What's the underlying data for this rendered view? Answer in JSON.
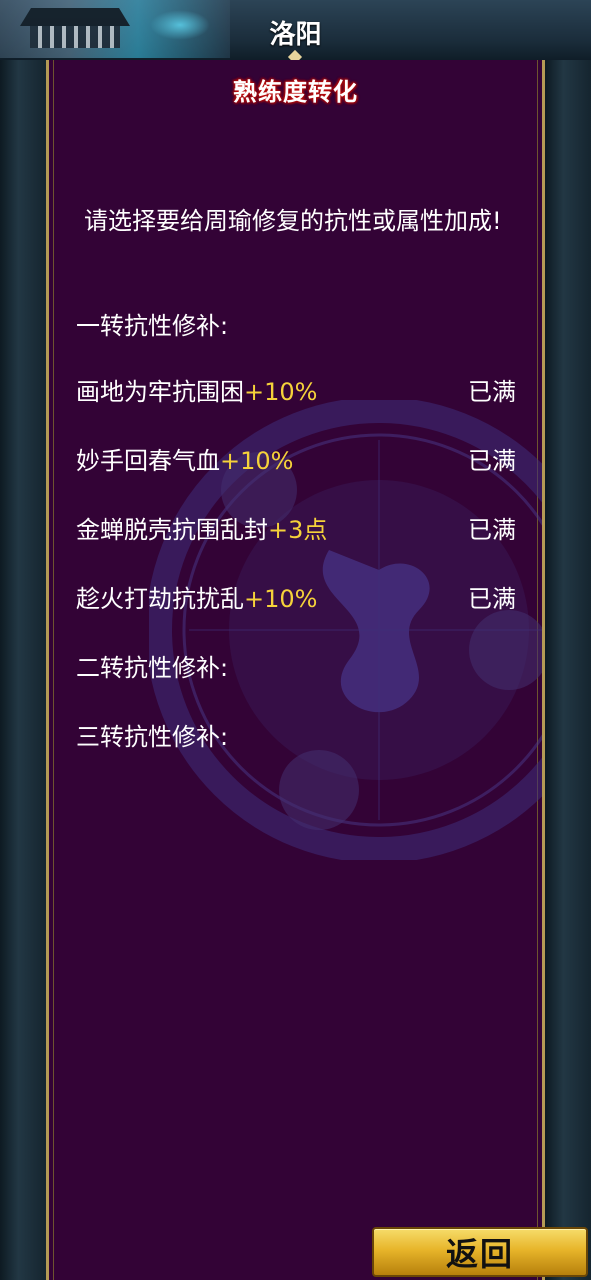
{
  "header": {
    "city_name": "洛阳"
  },
  "panel": {
    "title": "熟练度转化",
    "intro": "请选择要给周瑜修复的抗性或属性加成!",
    "sections": [
      {
        "label": "一转抗性修补:"
      },
      {
        "label": "二转抗性修补:"
      },
      {
        "label": "三转抗性修补:"
      }
    ],
    "items": [
      {
        "name": "画地为牢抗围困",
        "bonus": "+10%",
        "status": "已满"
      },
      {
        "name": "妙手回春气血",
        "bonus": "+10%",
        "status": "已满"
      },
      {
        "name": "金蝉脱壳抗围乱封",
        "bonus": "+3点",
        "status": "已满"
      },
      {
        "name": "趁火打劫抗扰乱",
        "bonus": "+10%",
        "status": "已满"
      }
    ]
  },
  "footer": {
    "back_label": "返回"
  },
  "colors": {
    "panel_bg": "#330336",
    "bonus_text": "#f5d23a",
    "title_glow": "#c01010",
    "button_gold": "#e7b52a"
  }
}
